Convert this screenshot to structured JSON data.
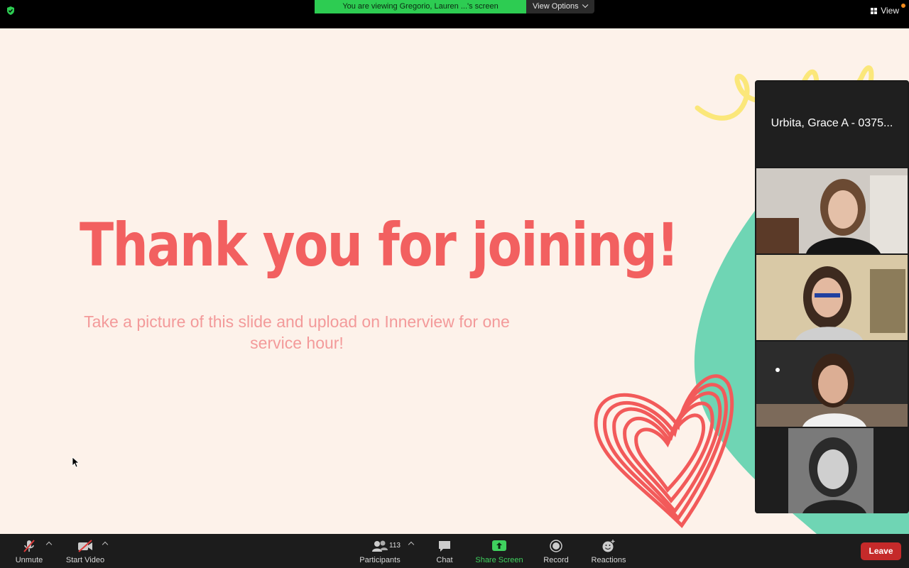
{
  "top_bar": {
    "banner_text": "You are viewing Gregorio, Lauren ...'s screen",
    "view_options_label": "View Options",
    "view_label": "View"
  },
  "slide": {
    "title": "Thank you for joining!",
    "subtitle": "Take a picture of this slide and upload on Innerview for one service hour!"
  },
  "gallery": {
    "name_tile": "Urbita, Grace A - 0375..."
  },
  "toolbar": {
    "unmute": "Unmute",
    "start_video": "Start Video",
    "participants": "Participants",
    "participants_count": "113",
    "chat": "Chat",
    "share_screen": "Share Screen",
    "record": "Record",
    "reactions": "Reactions",
    "leave": "Leave"
  },
  "colors": {
    "banner_green": "#2dcc52",
    "leave_red": "#c52a2a",
    "title_coral": "#f26060",
    "active_speaker": "#3fcf5a"
  }
}
